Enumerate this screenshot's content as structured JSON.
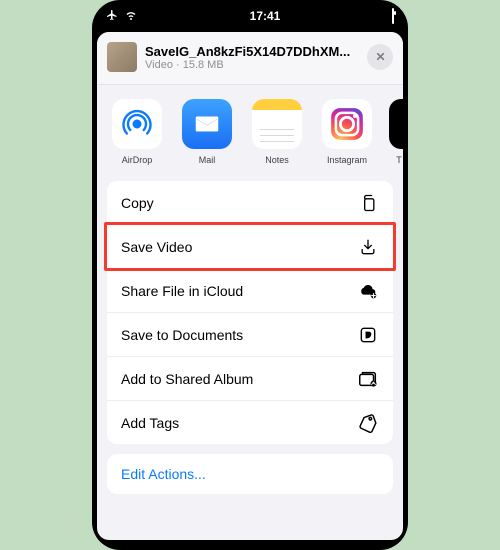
{
  "status": {
    "time": "17:41"
  },
  "sheet": {
    "file_name": "SaveIG_An8kzFi5X14D7DDhXM...",
    "file_meta": "Video · 15.8 MB"
  },
  "share_targets": {
    "airdrop": "AirDrop",
    "mail": "Mail",
    "notes": "Notes",
    "instagram": "Instagram",
    "tiktok": "T"
  },
  "actions": {
    "copy": "Copy",
    "save_video": "Save Video",
    "share_icloud": "Share File in iCloud",
    "save_documents": "Save to Documents",
    "shared_album": "Add to Shared Album",
    "add_tags": "Add Tags"
  },
  "edit_actions": "Edit Actions..."
}
